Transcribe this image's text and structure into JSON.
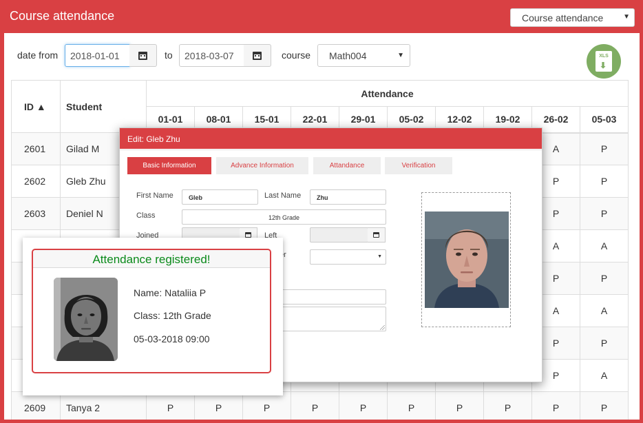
{
  "app": {
    "title": "Course attendance",
    "view_select": "Course attendance"
  },
  "filters": {
    "date_from_label": "date from",
    "date_from": "2018-01-01",
    "to_label": "to",
    "date_to": "2018-03-07",
    "course_label": "course",
    "course": "Math004",
    "export_icon_text": "XLS"
  },
  "table": {
    "id_header": "ID ▲",
    "student_header": "Student",
    "attendance_header": "Attendance",
    "dates": [
      "01-01",
      "08-01",
      "15-01",
      "22-01",
      "29-01",
      "05-02",
      "12-02",
      "19-02",
      "26-02",
      "05-03"
    ],
    "rows": [
      {
        "id": "2601",
        "student": "Gilad M",
        "marks": [
          "",
          "",
          "",
          "",
          "",
          "",
          "",
          "",
          "A",
          "P"
        ]
      },
      {
        "id": "2602",
        "student": "Gleb Zhu",
        "marks": [
          "",
          "",
          "",
          "",
          "",
          "",
          "",
          "",
          "P",
          "P"
        ]
      },
      {
        "id": "2603",
        "student": "Deniel N",
        "marks": [
          "",
          "",
          "",
          "",
          "",
          "",
          "",
          "",
          "P",
          "P"
        ]
      },
      {
        "id": "",
        "student": "",
        "marks": [
          "",
          "",
          "",
          "",
          "",
          "",
          "",
          "",
          "A",
          "A"
        ]
      },
      {
        "id": "",
        "student": "",
        "marks": [
          "",
          "",
          "",
          "",
          "",
          "",
          "",
          "",
          "P",
          "P"
        ]
      },
      {
        "id": "",
        "student": "",
        "marks": [
          "",
          "",
          "",
          "",
          "",
          "",
          "",
          "",
          "A",
          "A"
        ]
      },
      {
        "id": "",
        "student": "",
        "marks": [
          "",
          "",
          "",
          "",
          "",
          "",
          "",
          "",
          "P",
          "P"
        ]
      },
      {
        "id": "",
        "student": "",
        "marks": [
          "",
          "",
          "",
          "",
          "",
          "",
          "",
          "",
          "P",
          "A"
        ]
      },
      {
        "id": "2609",
        "student": "Tanya 2",
        "marks": [
          "P",
          "P",
          "P",
          "P",
          "P",
          "P",
          "P",
          "P",
          "P",
          "P"
        ]
      }
    ]
  },
  "edit_dialog": {
    "title": "Edit: Gleb Zhu",
    "tabs": [
      "Basic Information",
      "Advance Information",
      "Attandance",
      "Verification"
    ],
    "first_name_label": "First Name",
    "first_name": "Gleb",
    "last_name_label": "Last Name",
    "last_name": "Zhu",
    "class_label": "Class",
    "class_value": "12th Grade",
    "joined_label": "Joined",
    "left_label": "Left",
    "partial_label": "er"
  },
  "notice": {
    "title": "Attendance registered!",
    "name": "Name: Nataliia P",
    "class": "Class: 12th Grade",
    "timestamp": "05-03-2018 09:00"
  },
  "icons": {
    "calendar": "calendar-icon",
    "export": "excel-export-icon",
    "caret": "caret-down-icon"
  },
  "colors": {
    "brand": "#d94043",
    "success": "#0a8a1a",
    "export": "#7fad62"
  }
}
